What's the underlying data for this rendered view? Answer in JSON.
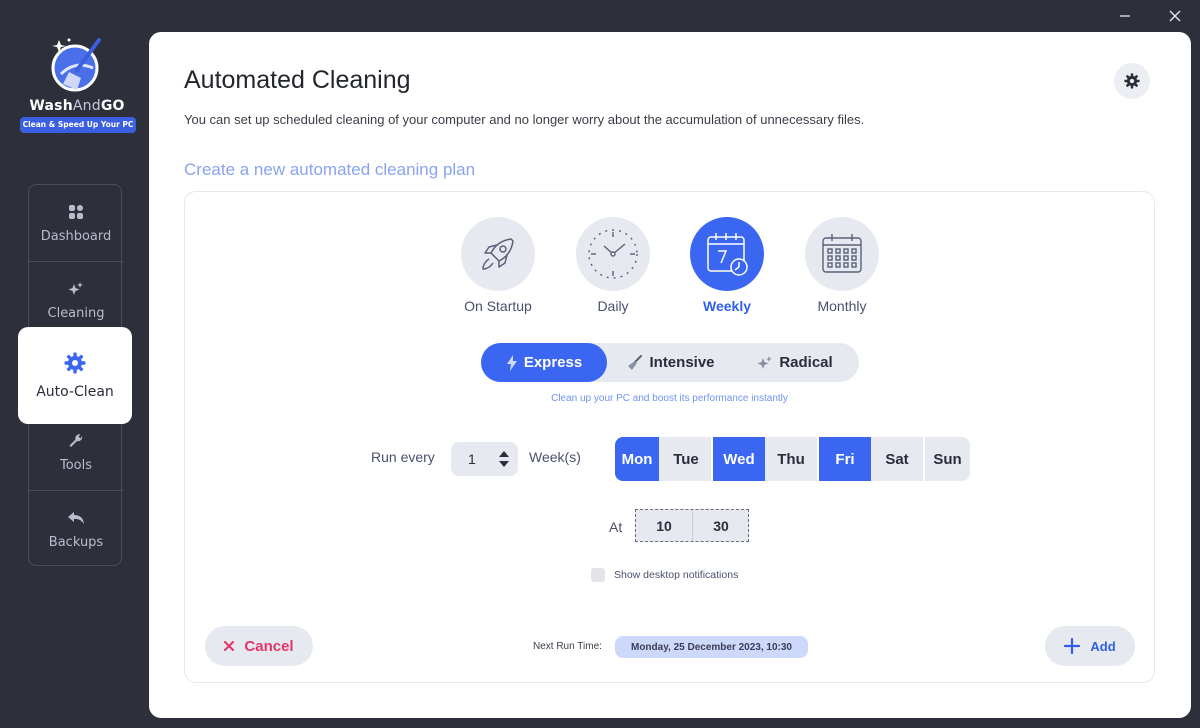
{
  "window": {
    "minimize_icon": "minimize-icon",
    "close_icon": "close-icon"
  },
  "brand": {
    "name_wash": "Wash",
    "name_and": "And",
    "name_go": "GO",
    "tagline": "Clean & Speed Up Your PC"
  },
  "sidebar": {
    "items": [
      {
        "label": "Dashboard",
        "icon": "dashboard-icon"
      },
      {
        "label": "Cleaning",
        "icon": "sparkle-icon"
      },
      {
        "label": "Auto-Clean",
        "icon": "gear-icon",
        "active": true
      },
      {
        "label": "Tools",
        "icon": "wrench-icon"
      },
      {
        "label": "Backups",
        "icon": "undo-arrow-icon"
      }
    ]
  },
  "main": {
    "title": "Automated Cleaning",
    "subtitle": "You can set up scheduled cleaning of your computer and no longer worry about the accumulation of unnecessary files.",
    "section_title": "Create a new automated cleaning plan"
  },
  "frequencies": [
    {
      "label": "On Startup",
      "icon": "rocket-icon"
    },
    {
      "label": "Daily",
      "icon": "clock-icon"
    },
    {
      "label": "Weekly",
      "icon": "calendar-7-icon",
      "active": true
    },
    {
      "label": "Monthly",
      "icon": "calendar-grid-icon"
    }
  ],
  "modes": [
    {
      "label": "Express",
      "icon": "lightning-icon",
      "active": true
    },
    {
      "label": "Intensive",
      "icon": "broom-icon"
    },
    {
      "label": "Radical",
      "icon": "sparkle-icon"
    }
  ],
  "mode_hint": "Clean up your PC and boost its performance instantly",
  "schedule": {
    "run_every_label": "Run every",
    "interval_value": "1",
    "interval_unit": "Week(s)",
    "days": [
      {
        "label": "Mon",
        "selected": true
      },
      {
        "label": "Tue",
        "selected": false
      },
      {
        "label": "Wed",
        "selected": true
      },
      {
        "label": "Thu",
        "selected": false
      },
      {
        "label": "Fri",
        "selected": true
      },
      {
        "label": "Sat",
        "selected": false
      },
      {
        "label": "Sun",
        "selected": false
      }
    ],
    "at_label": "At",
    "hour": "10",
    "minute": "30",
    "notifications_label": "Show desktop notifications",
    "notifications_checked": false
  },
  "footer": {
    "cancel_label": "Cancel",
    "next_run_label": "Next Run Time:",
    "next_run_value": "Monday, 25 December 2023, 10:30",
    "add_label": "Add"
  },
  "colors": {
    "accent": "#3a66f2",
    "cancel": "#e0366a",
    "sidebar_bg": "#2d2f3a",
    "hint": "#6f93f2"
  }
}
